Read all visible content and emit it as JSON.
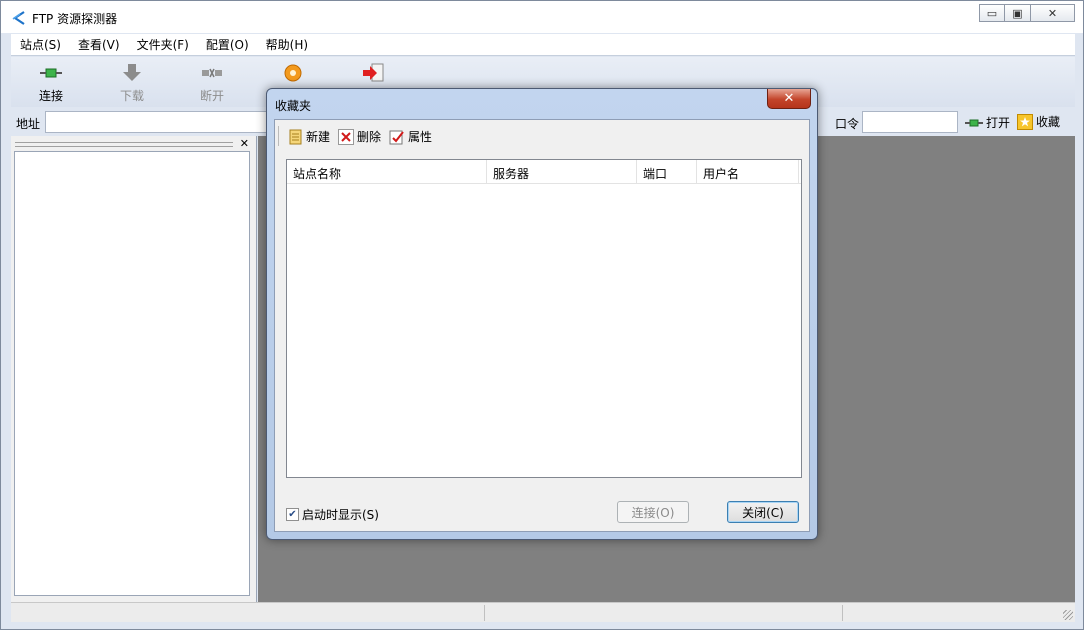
{
  "window": {
    "title": "FTP 资源探测器"
  },
  "window_buttons": {
    "minimize": "▭",
    "maximize": "▣",
    "close": "✕"
  },
  "menu": [
    {
      "label": "站点(S)"
    },
    {
      "label": "查看(V)"
    },
    {
      "label": "文件夹(F)"
    },
    {
      "label": "配置(O)"
    },
    {
      "label": "帮助(H)"
    }
  ],
  "toolbar": {
    "connect": "连接",
    "download": "下载",
    "disconnect": "断开"
  },
  "addressbar": {
    "address_label": "地址",
    "password_label": "口令",
    "open_label": "打开",
    "favorite_label": "收藏"
  },
  "dialog": {
    "title": "收藏夹",
    "toolbar": {
      "new": "新建",
      "delete": "删除",
      "properties": "属性"
    },
    "columns": [
      "站点名称",
      "服务器",
      "端口",
      "用户名"
    ],
    "show_on_startup": "启动时显示(S)",
    "show_on_startup_checked": true,
    "connect_button": "连接(O)",
    "close_button": "关闭(C)"
  },
  "colors": {
    "accent": "#dfe6f1",
    "content_bg": "#808080"
  }
}
